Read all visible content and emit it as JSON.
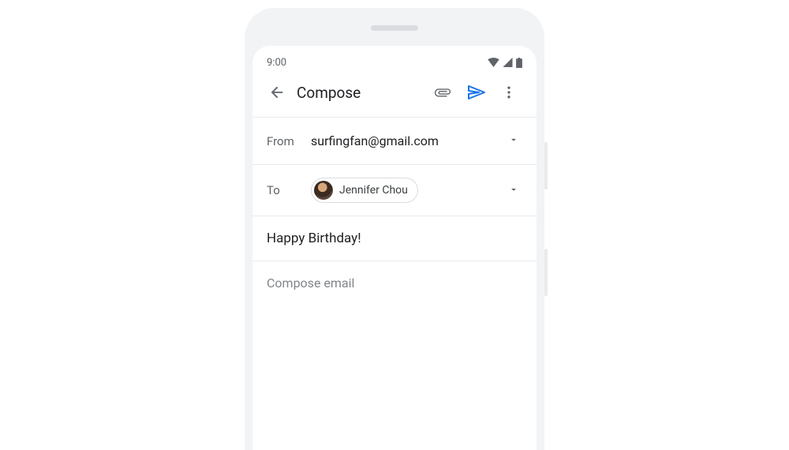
{
  "status": {
    "time": "9:00"
  },
  "appbar": {
    "title": "Compose"
  },
  "from": {
    "label": "From",
    "value": "surfingfan@gmail.com"
  },
  "to": {
    "label": "To",
    "chip_name": "Jennifer Chou"
  },
  "subject": {
    "value": "Happy Birthday!"
  },
  "body": {
    "placeholder": "Compose email"
  },
  "colors": {
    "send_icon": "#1a73e8",
    "icons": "#5f6368"
  }
}
